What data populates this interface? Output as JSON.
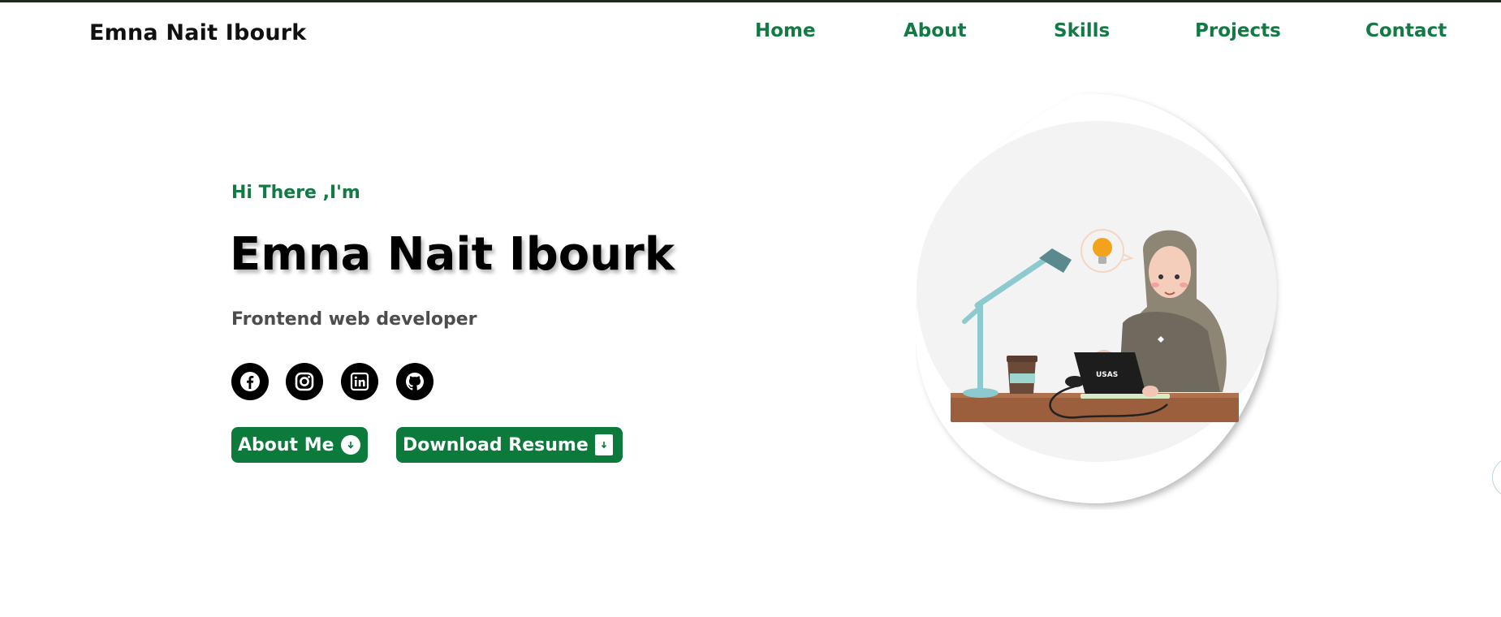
{
  "header": {
    "brand": "Emna Nait Ibourk",
    "nav": [
      {
        "label": "Home"
      },
      {
        "label": "About"
      },
      {
        "label": "Skills"
      },
      {
        "label": "Projects"
      },
      {
        "label": "Contact"
      }
    ]
  },
  "hero": {
    "greeting": "Hi There ,I'm",
    "name": "Emna Nait Ibourk",
    "role": "Frontend web developer",
    "socials": [
      {
        "icon": "facebook-icon"
      },
      {
        "icon": "instagram-icon"
      },
      {
        "icon": "linkedin-icon"
      },
      {
        "icon": "github-icon"
      }
    ],
    "buttons": {
      "about_label": "About Me",
      "resume_label": "Download Resume"
    }
  },
  "illustration": {
    "laptop_label": "USAS"
  },
  "colors": {
    "accent": "#137a45",
    "button": "#0b7a3a",
    "text": "#000000",
    "muted": "#4d4d4d"
  }
}
